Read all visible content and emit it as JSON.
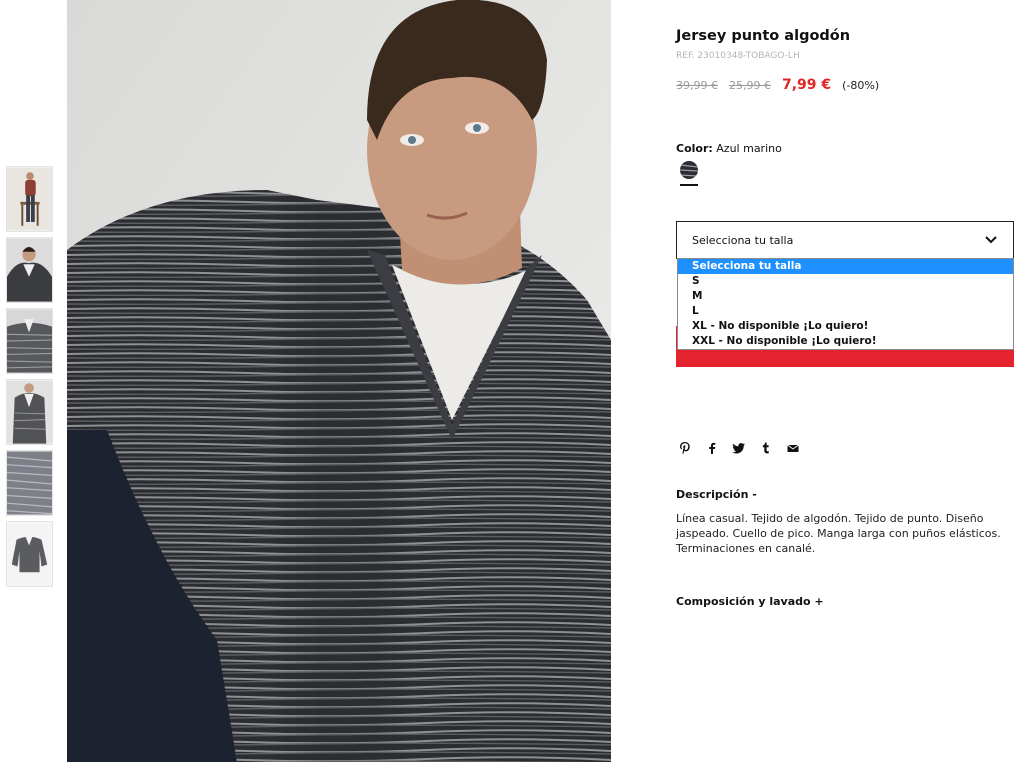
{
  "product": {
    "title": "Jersey punto algodón",
    "ref": "REF. 23010348-TOBAGO-LH",
    "prices": {
      "original": "39,99 €",
      "previous": "25,99 €",
      "current": "7,99 €",
      "discount": "(-80%)"
    },
    "color": {
      "label": "Color:",
      "value": "Azul marino"
    },
    "size_select": {
      "placeholder": "Selecciona tu talla",
      "options": [
        "Selecciona tu talla",
        "S",
        "M",
        "L",
        "XL - No disponible ¡Lo quiero!",
        "XXL - No disponible ¡Lo quiero!"
      ],
      "selected_index": 0
    },
    "share_icons": [
      "pinterest-icon",
      "facebook-icon",
      "twitter-icon",
      "tumblr-icon",
      "email-icon"
    ],
    "description": {
      "heading": "Descripción  -",
      "text": "Línea casual. Tejido de algodón. Tejido de punto. Diseño jaspeado. Cuello de pico. Manga larga con puños elásticos. Terminaciones en canalé."
    },
    "composition": {
      "heading": "Composición y lavado  +"
    }
  },
  "colors": {
    "price_red": "#e32424",
    "button_red": "#e4232f",
    "highlight_blue": "#1e90ff"
  }
}
